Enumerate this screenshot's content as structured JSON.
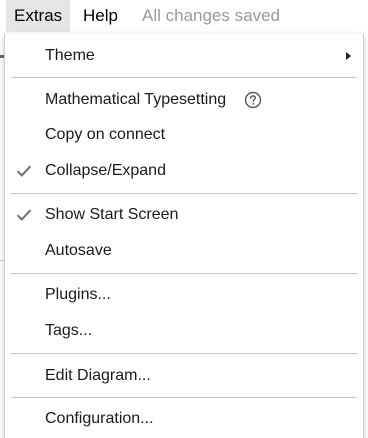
{
  "menubar": {
    "extras_label": "Extras",
    "help_label": "Help",
    "status": "All changes saved"
  },
  "extras_menu": {
    "theme": {
      "label": "Theme",
      "has_submenu": true
    },
    "math": {
      "label": "Mathematical Typesetting",
      "help_icon": "help-circle-icon"
    },
    "copy_on_connect": {
      "label": "Copy on connect",
      "checked": false
    },
    "collapse_expand": {
      "label": "Collapse/Expand",
      "checked": true
    },
    "show_start_screen": {
      "label": "Show Start Screen",
      "checked": true
    },
    "autosave": {
      "label": "Autosave",
      "checked": false
    },
    "plugins": {
      "label": "Plugins..."
    },
    "tags": {
      "label": "Tags..."
    },
    "edit_diagram": {
      "label": "Edit Diagram..."
    },
    "configuration": {
      "label": "Configuration..."
    }
  },
  "colors": {
    "check": "#707070",
    "active_menu_bg": "#e5e5e5",
    "status_text": "#9a9a9a",
    "separator": "#c8c8c8"
  }
}
